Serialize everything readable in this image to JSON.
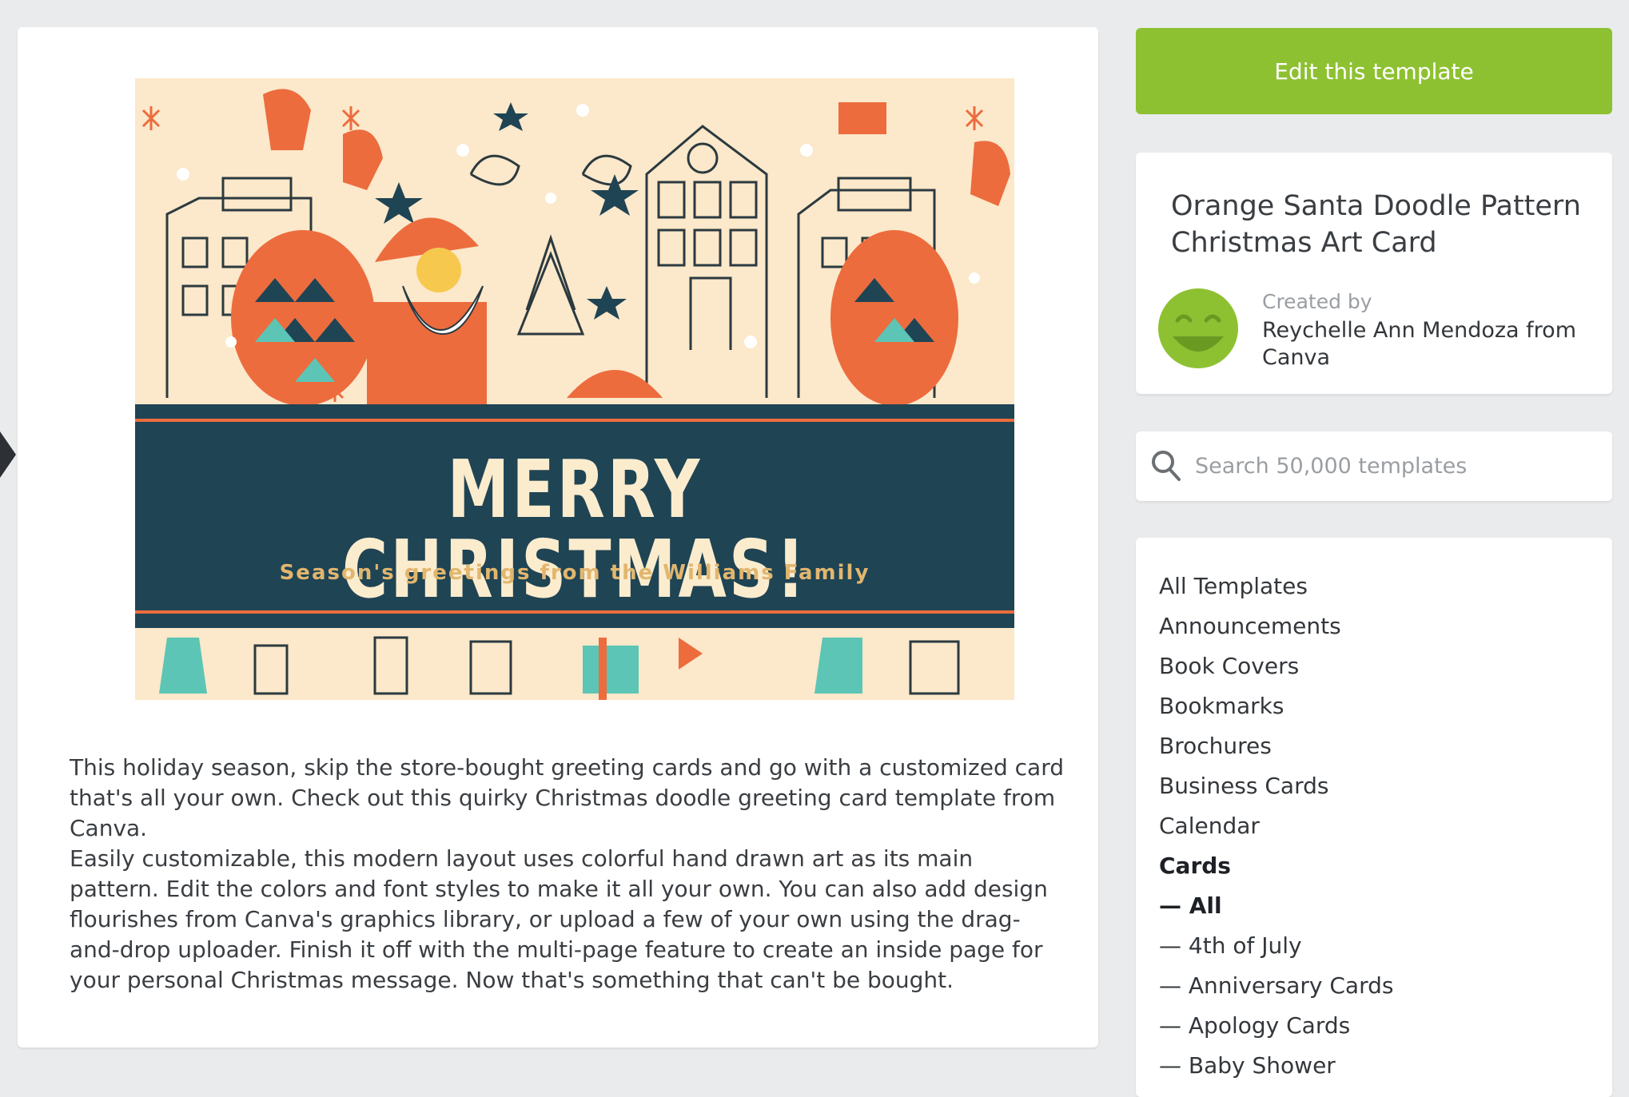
{
  "template": {
    "card_headline": "MERRY CHRISTMAS!",
    "card_subline": "Season's greetings from the Williams Family",
    "description": [
      "This holiday season, skip the store-bought greeting cards and go with a customized card that's all your own. Check out this quirky Christmas doodle greeting card template from Canva.",
      "Easily customizable, this modern layout uses colorful hand drawn art as its main pattern. Edit the colors and font styles to make it all your own. You can also add design flourishes from Canva's graphics library, or upload a few of your own using the drag-and-drop uploader. Finish it off with the multi-page feature to create an inside page for your personal Christmas message. Now that's something that can't be bought."
    ]
  },
  "sidebar": {
    "edit_button_label": "Edit this template",
    "title": "Orange Santa Doodle Pattern Christmas Art Card",
    "created_by_label": "Created by",
    "creator": "Reychelle Ann Mendoza from Canva",
    "search_placeholder": "Search 50,000 templates",
    "categories": [
      {
        "label": "All Templates"
      },
      {
        "label": "Announcements"
      },
      {
        "label": "Book Covers"
      },
      {
        "label": "Bookmarks"
      },
      {
        "label": "Brochures"
      },
      {
        "label": "Business Cards"
      },
      {
        "label": "Calendar"
      },
      {
        "label": "Cards"
      },
      {
        "label": "— All"
      },
      {
        "label": "— 4th of July"
      },
      {
        "label": "— Anniversary Cards"
      },
      {
        "label": "— Apology Cards"
      },
      {
        "label": "— Baby Shower"
      }
    ]
  },
  "colors": {
    "accent_green": "#8ec132",
    "banner_navy": "#1f4454",
    "card_orange": "#ec6c3e",
    "card_teal": "#5cc5b5",
    "card_cream": "#fce8ca"
  },
  "icons": {
    "prev": "chevron-left-arrow",
    "search": "magnifier",
    "avatar": "smiley-face"
  }
}
